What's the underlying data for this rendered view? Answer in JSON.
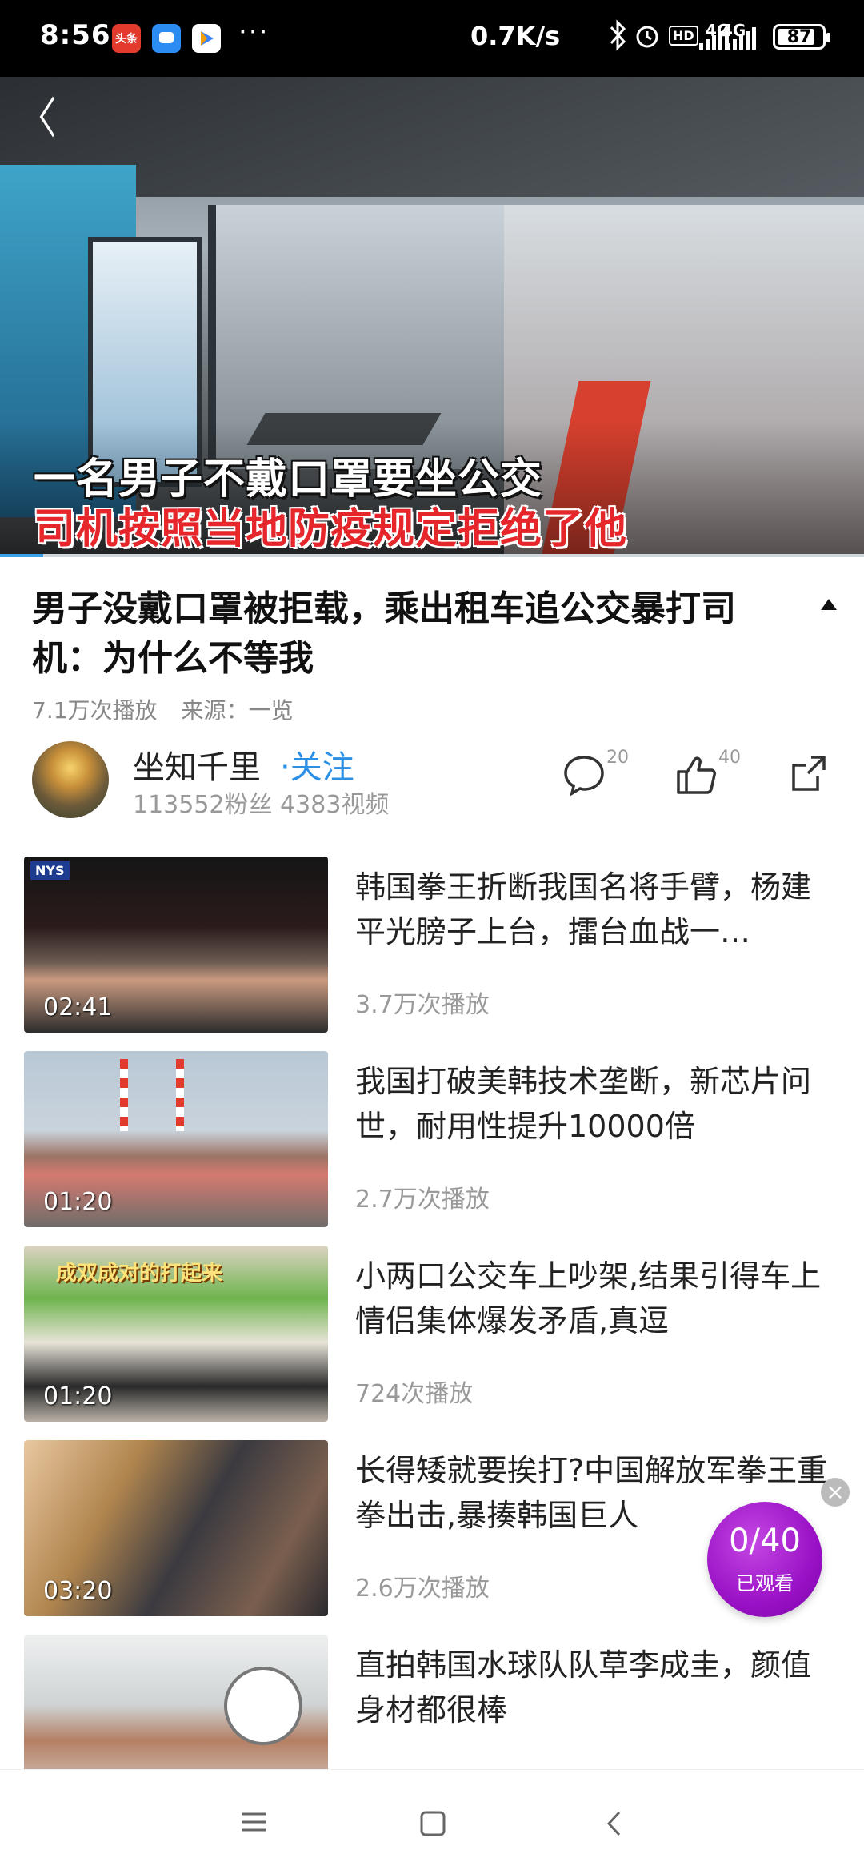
{
  "status_bar": {
    "time": "8:56",
    "app1": "头条",
    "more_dots": "···",
    "net_speed": "0.7K/s",
    "net1": "4G",
    "net2": "4G",
    "hd": "HD",
    "battery": "87"
  },
  "video": {
    "caption_line1": "一名男子不戴口罩要坐公交",
    "caption_line2": "司机按照当地防疫规定拒绝了他",
    "progress": 0.05
  },
  "article": {
    "title": "男子没戴口罩被拒载，乘出租车追公交暴打司机：为什么不等我",
    "plays": "7.1万次播放",
    "source": "来源：一览"
  },
  "author": {
    "name": "坐知千里",
    "follow_label": "·关注",
    "stats": "113552粉丝  4383视频"
  },
  "actions": {
    "comments": "20",
    "likes": "40"
  },
  "related": [
    {
      "title": "韩国拳王折断我国名将手臂，杨建平光膀子上台，擂台血战一…",
      "plays": "3.7万次播放",
      "duration": "02:41",
      "badge": "NYS"
    },
    {
      "title": "我国打破美韩技术垄断，新芯片问世，耐用性提升10000倍",
      "plays": "2.7万次播放",
      "duration": "01:20"
    },
    {
      "title": "小两口公交车上吵架,结果引得车上情侣集体爆发矛盾,真逗",
      "plays": "724次播放",
      "duration": "01:20",
      "banner": "成双成对的打起来"
    },
    {
      "title": "长得矮就要挨打?中国解放军拳王重拳出击,暴揍韩国巨人",
      "plays": "2.6万次播放",
      "duration": "03:20"
    },
    {
      "title": "直拍韩国水球队队草李成圭，颜值身材都很棒",
      "plays": "",
      "duration": ""
    }
  ],
  "watch_badge": {
    "count": "0/40",
    "label": "已观看"
  },
  "colors": {
    "accent": "#2c8fe6",
    "badge_purple": "#9a12c6",
    "caption_red": "#e5262b"
  }
}
